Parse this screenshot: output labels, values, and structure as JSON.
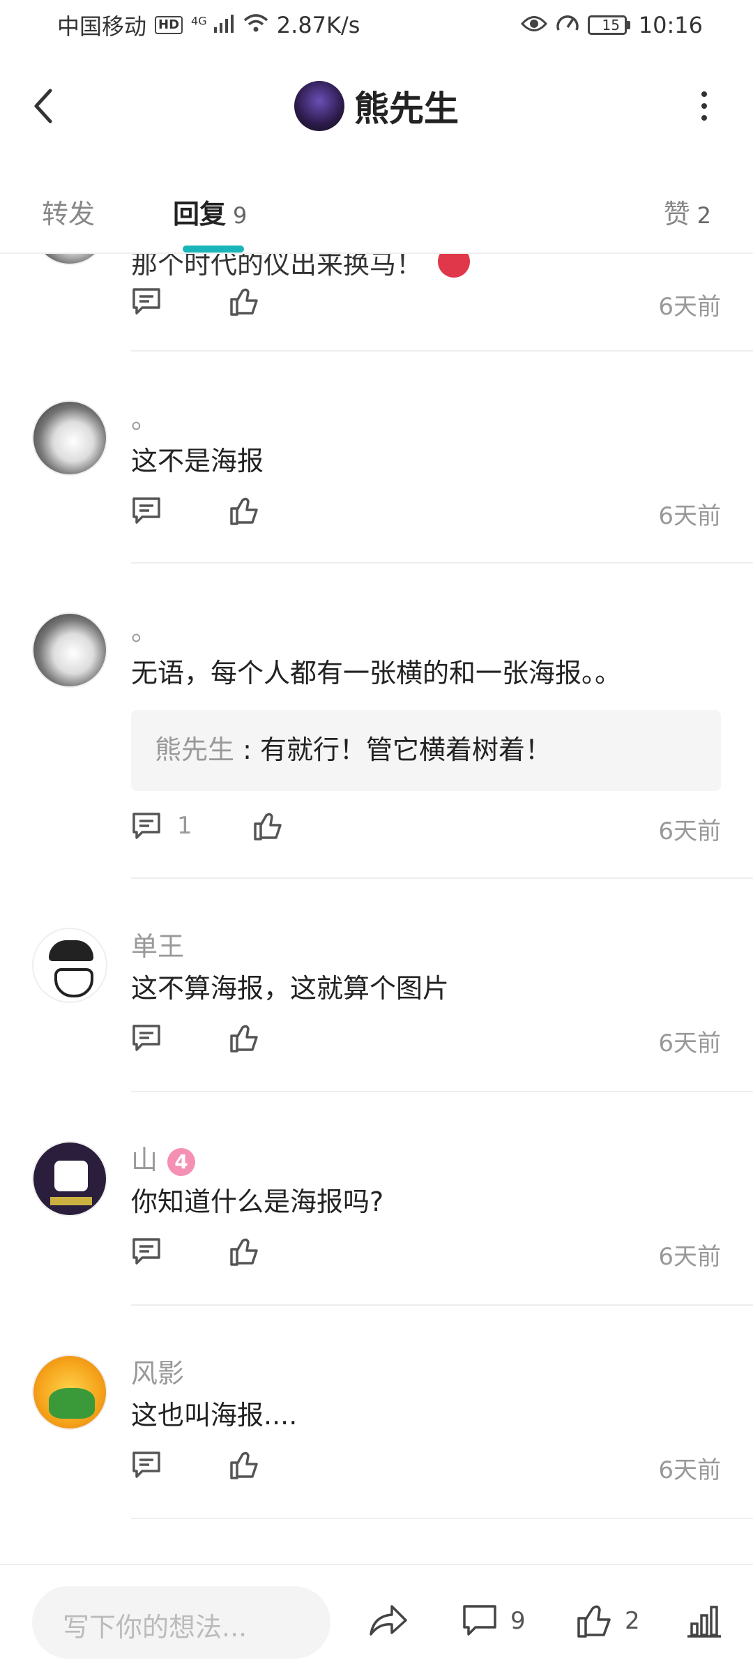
{
  "status_bar": {
    "carrier": "中国移动",
    "hd": "HD",
    "network": "4G",
    "speed": "2.87K/s",
    "battery": "15",
    "time": "10:16",
    "icons": [
      "signal-icon",
      "wifi-icon",
      "eye-icon",
      "speed-icon",
      "battery-icon"
    ]
  },
  "header": {
    "title": "熊先生",
    "back_icon": "chevron-left-icon",
    "more_icon": "more-vertical-icon"
  },
  "tabs": {
    "repost": {
      "label": "转发"
    },
    "reply": {
      "label": "回复",
      "count": "9"
    },
    "like": {
      "label": "赞",
      "count": "2"
    }
  },
  "comments": [
    {
      "name": "",
      "content": "那个时代的仪出来换马！",
      "time": "6天前",
      "reply_count": ""
    },
    {
      "name": "。",
      "content": "这不是海报",
      "time": "6天前",
      "reply_count": ""
    },
    {
      "name": "。",
      "content": "无语，每个人都有一张横的和一张海报。。",
      "time": "6天前",
      "reply_count": "1",
      "quote": {
        "name": "熊先生",
        "sep": " : ",
        "text": "有就行！管它横着树着！"
      }
    },
    {
      "name": "单王",
      "content": "这不算海报，这就算个图片",
      "time": "6天前",
      "reply_count": ""
    },
    {
      "name": "山",
      "badge": "4",
      "content": "你知道什么是海报吗?",
      "time": "6天前",
      "reply_count": ""
    },
    {
      "name": "风影",
      "content": "这也叫海报....",
      "time": "6天前",
      "reply_count": ""
    }
  ],
  "bottom_bar": {
    "placeholder": "写下你的想法...",
    "comment_count": "9",
    "like_count": "2",
    "icons": [
      "share-icon",
      "comment-icon",
      "like-icon",
      "stats-icon"
    ]
  }
}
